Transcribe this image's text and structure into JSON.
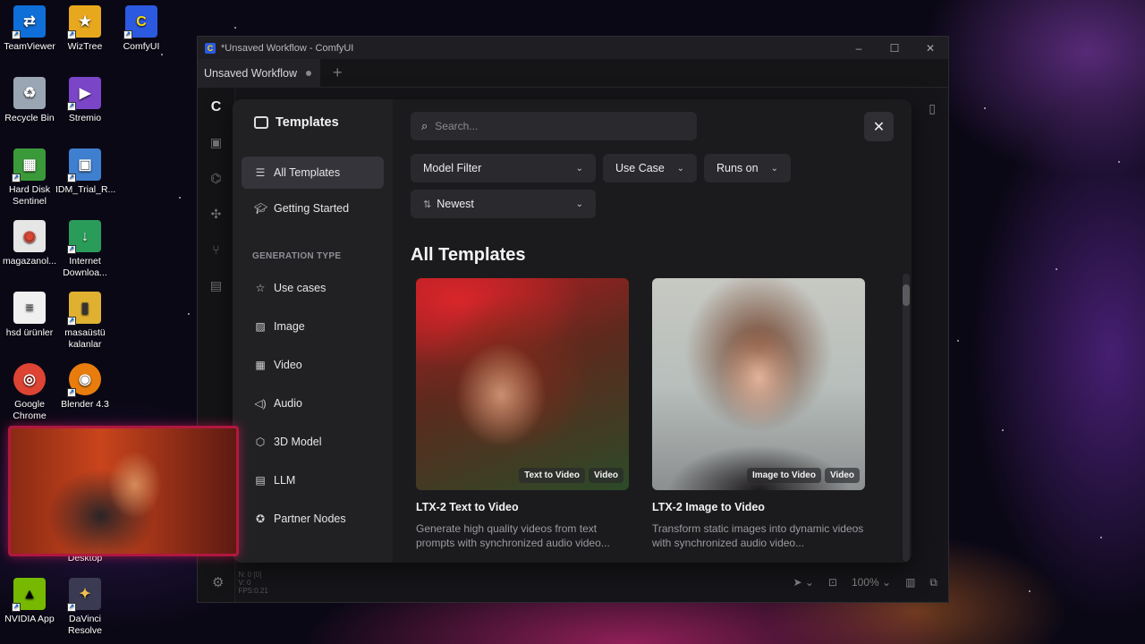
{
  "desktop": {
    "icons": [
      {
        "label": "TeamViewer",
        "color": "#0e6fd8",
        "glyph": "⇄"
      },
      {
        "label": "WizTree",
        "color": "#e8a81e",
        "glyph": "★"
      },
      {
        "label": "ComfyUI",
        "color": "#2b59e0",
        "glyph": "C"
      },
      {
        "label": "Recycle Bin",
        "color": "#9aa6b4",
        "glyph": "♻"
      },
      {
        "label": "Stremio",
        "color": "#7b45c8",
        "glyph": "▶"
      },
      {
        "label": "Hard Disk Sentinel",
        "color": "#3a9a3a",
        "glyph": "▦"
      },
      {
        "label": "IDM_Trial_R...",
        "color": "#3f7fd0",
        "glyph": "▣"
      },
      {
        "label": "magazanol...",
        "color": "#e6e6e6",
        "glyph": "◉"
      },
      {
        "label": "Internet Downloa...",
        "color": "#2a9c5a",
        "glyph": "↓"
      },
      {
        "label": "hsd ürünler",
        "color": "#f0f0f0",
        "glyph": "≡"
      },
      {
        "label": "masaüstü kalanlar",
        "color": "#e0b030",
        "glyph": "▮"
      },
      {
        "label": "Google Chrome",
        "color": "#dd4433",
        "glyph": "◎"
      },
      {
        "label": "Blender 4.3",
        "color": "#e87d0d",
        "glyph": "◉"
      },
      {
        "label": "Desktop",
        "color": "transparent",
        "glyph": ""
      },
      {
        "label": "NVIDIA App",
        "color": "#76b900",
        "glyph": "▲"
      },
      {
        "label": "DaVinci Resolve",
        "color": "#3a3a52",
        "glyph": "✦"
      }
    ]
  },
  "window": {
    "title": "*Unsaved Workflow - ComfyUI",
    "tab_label": "Unsaved Workflow",
    "stats": [
      "N: 0 [0]",
      "V: 0",
      "FPS:0.21"
    ],
    "zoom": "100%"
  },
  "modal": {
    "title": "Templates",
    "nav": [
      {
        "label": "All Templates",
        "icon": "list-icon",
        "active": true
      },
      {
        "label": "Getting Started",
        "icon": "graduation-cap-icon"
      }
    ],
    "section_label": "GENERATION TYPE",
    "generation_types": [
      {
        "label": "Use cases",
        "icon": "star-icon"
      },
      {
        "label": "Image",
        "icon": "image-icon"
      },
      {
        "label": "Video",
        "icon": "film-icon"
      },
      {
        "label": "Audio",
        "icon": "speaker-icon"
      },
      {
        "label": "3D Model",
        "icon": "cube-icon"
      },
      {
        "label": "LLM",
        "icon": "text-box-icon"
      },
      {
        "label": "Partner Nodes",
        "icon": "badge-icon"
      }
    ],
    "search_placeholder": "Search...",
    "filters": {
      "model": "Model Filter",
      "use_case": "Use Case",
      "runs_on": "Runs on",
      "sort": "Newest"
    },
    "section_title": "All Templates",
    "cards": [
      {
        "title": "LTX-2 Text to Video",
        "description": "Generate high quality videos from text prompts with synchronized audio video...",
        "badges": [
          "Text to Video",
          "Video"
        ]
      },
      {
        "title": "LTX-2 Image to Video",
        "description": "Transform static images into dynamic videos with synchronized audio video...",
        "badges": [
          "Image to Video",
          "Video"
        ]
      }
    ]
  }
}
